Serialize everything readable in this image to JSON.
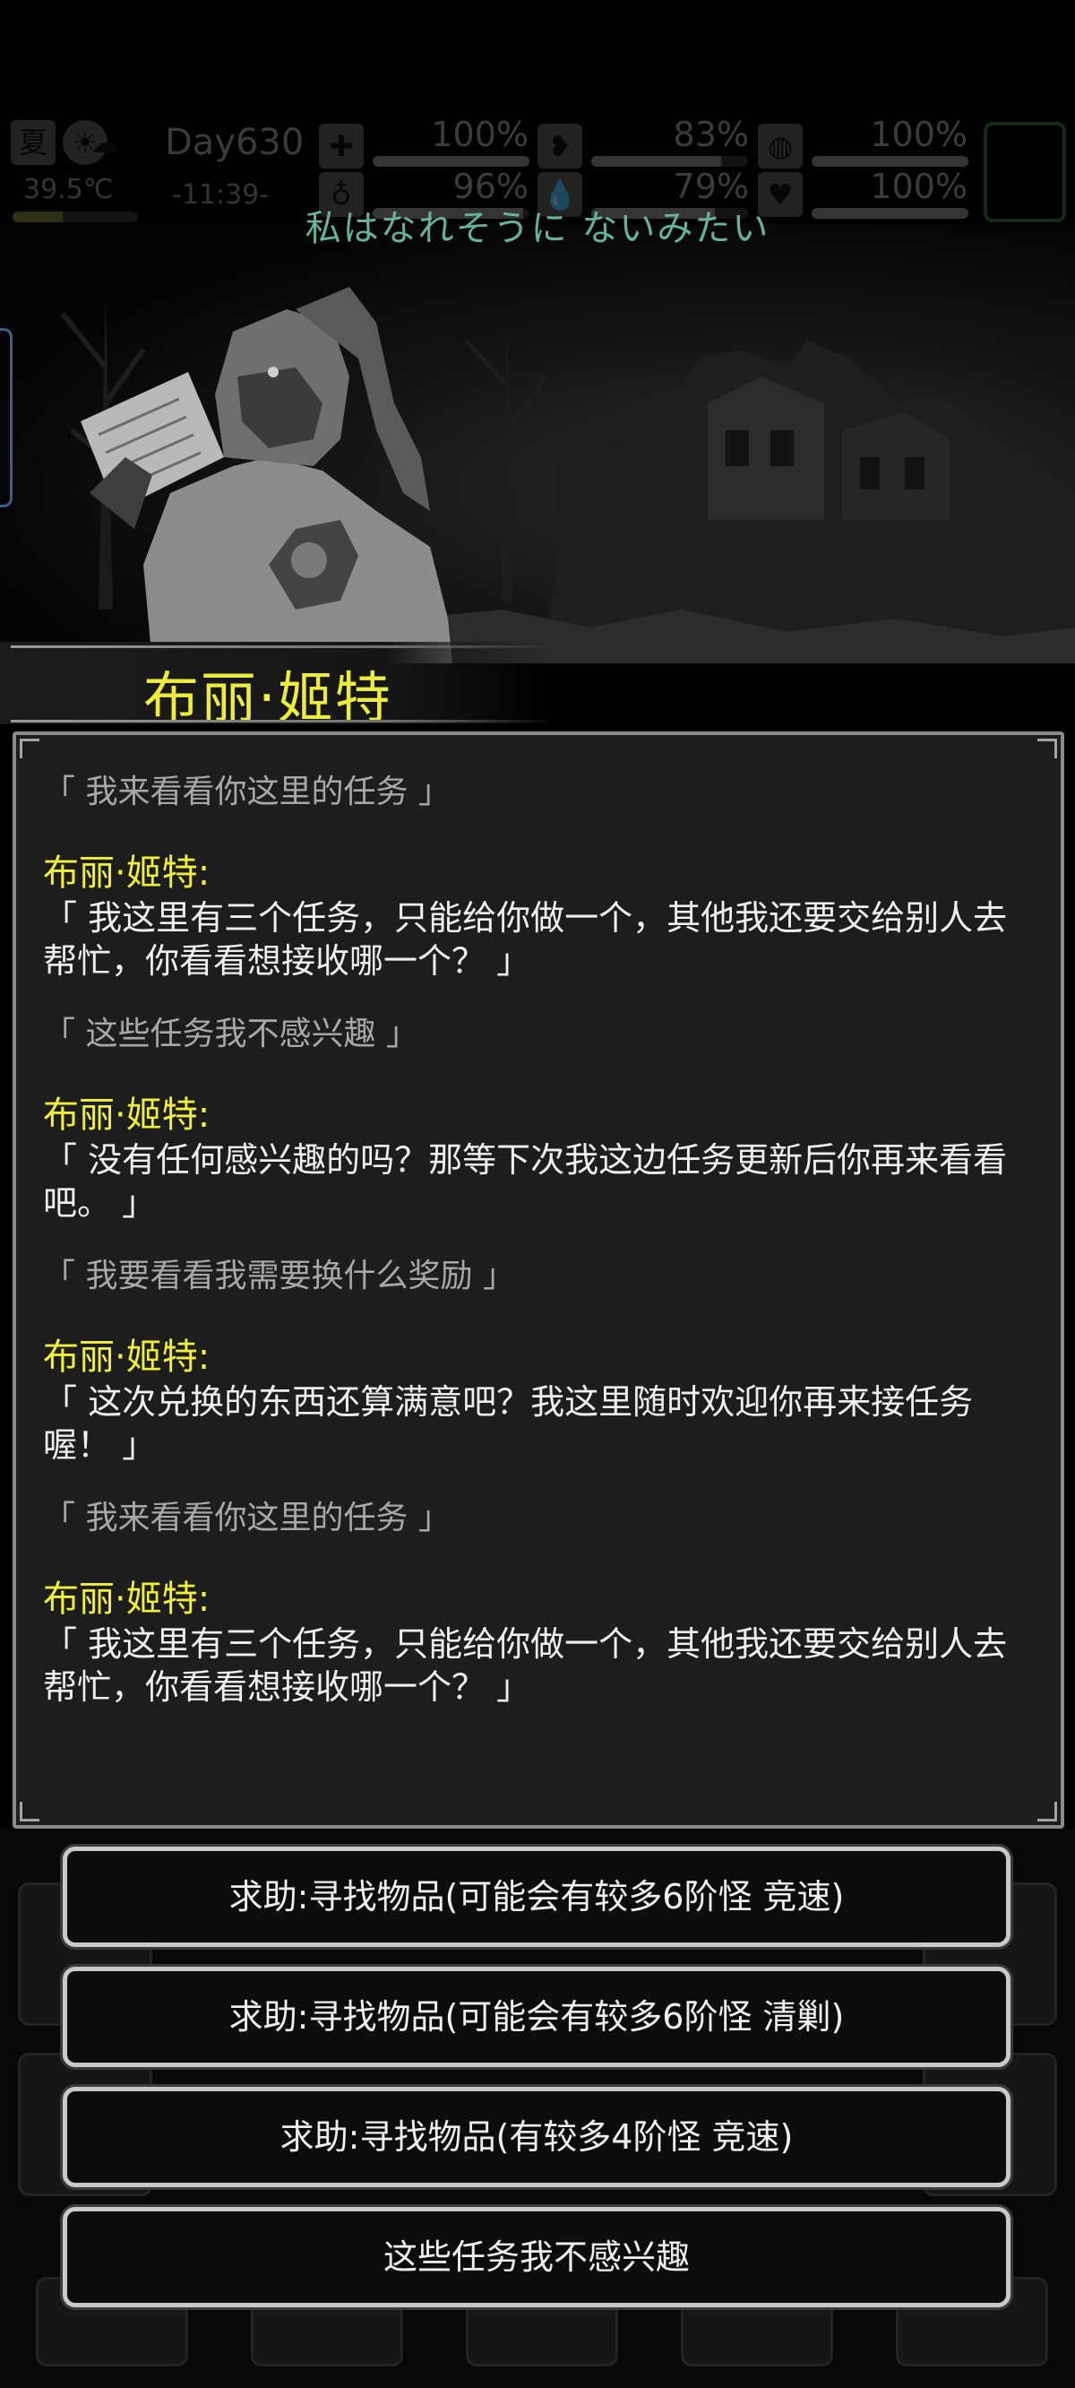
{
  "status": {
    "season": "夏",
    "temperature": "39.5℃",
    "day": "Day630",
    "time": "-11:39-",
    "health_pct": "100%",
    "health_fill": 1.0,
    "food_pct": "83%",
    "food_fill": 0.83,
    "stat3_pct": "100%",
    "stat3_fill": 1.0,
    "stat4_pct": "96%",
    "stat4_fill": 0.96,
    "water_pct": "79%",
    "water_fill": 0.79,
    "heart_pct": "100%",
    "heart_fill": 1.0,
    "icons": [
      "sun-icon",
      "weather-icon",
      "medkit-icon",
      "stomach-icon",
      "bladder-icon",
      "lungs-icon",
      "water-drop-icon",
      "heart-icon"
    ]
  },
  "subtitle": "私はなれそうに ないみたい",
  "npc": {
    "name": "布丽·姬特"
  },
  "dialog": [
    {
      "type": "player",
      "text": "「 我来看看你这里的任务 」"
    },
    {
      "type": "npc",
      "speaker": "布丽·姬特:",
      "text": "「 我这里有三个任务，只能给你做一个，其他我还要交给别人去帮忙，你看看想接收哪一个？ 」"
    },
    {
      "type": "player",
      "text": "「 这些任务我不感兴趣 」"
    },
    {
      "type": "npc",
      "speaker": "布丽·姬特:",
      "text": "「 没有任何感兴趣的吗？那等下次我这边任务更新后你再来看看吧。 」"
    },
    {
      "type": "player",
      "text": "「 我要看看我需要换什么奖励 」"
    },
    {
      "type": "npc",
      "speaker": "布丽·姬特:",
      "text": "「 这次兑换的东西还算满意吧？我这里随时欢迎你再来接任务喔！ 」"
    },
    {
      "type": "player",
      "text": "「 我来看看你这里的任务 」"
    },
    {
      "type": "npc",
      "speaker": "布丽·姬特:",
      "text": "「 我这里有三个任务，只能给你做一个，其他我还要交给别人去帮忙，你看看想接收哪一个？ 」"
    }
  ],
  "options": [
    "求助:寻找物品(可能会有较多6阶怪  竞速)",
    "求助:寻找物品(可能会有较多6阶怪  清剿)",
    "求助:寻找物品(有较多4阶怪  竞速)",
    "这些任务我不感兴趣"
  ],
  "colors": {
    "speaker": "#f0f03a",
    "subtitle": "#67b29a",
    "panel_bg": "#1d1d1d",
    "panel_border": "#8a8a8a"
  }
}
